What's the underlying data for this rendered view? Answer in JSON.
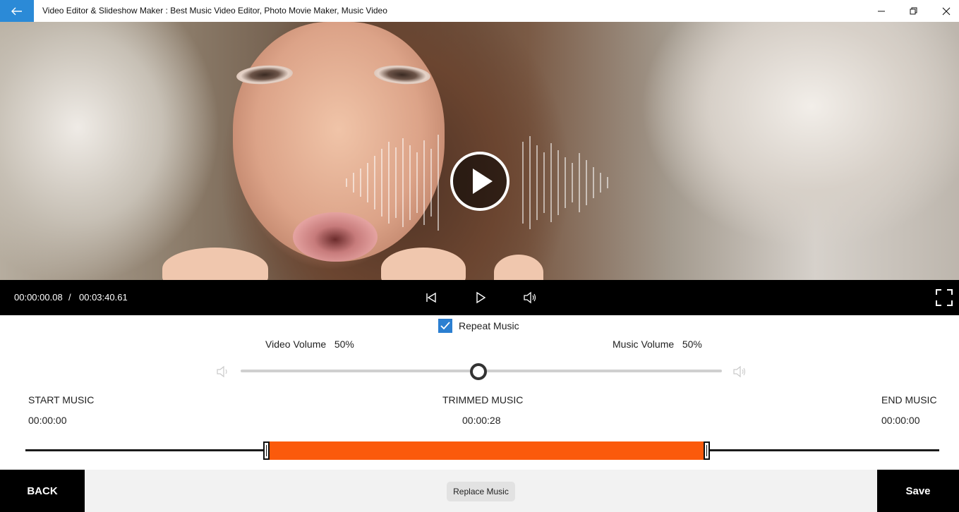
{
  "window": {
    "title": "Video Editor & Slideshow Maker : Best Music Video Editor, Photo Movie Maker, Music Video",
    "back_icon": "arrow-left-icon",
    "controls": [
      "minimize-icon",
      "restore-icon",
      "close-icon"
    ]
  },
  "player": {
    "current_time": "00:00:00.08",
    "separator": "/",
    "total_time": "00:03:40.61",
    "icons": [
      "skip-back-icon",
      "play-icon",
      "volume-icon",
      "fullscreen-icon"
    ]
  },
  "settings": {
    "repeat_music_label": "Repeat Music",
    "repeat_music_checked": true,
    "video_volume_label": "Video Volume",
    "video_volume_value": "50%",
    "music_volume_label": "Music Volume",
    "music_volume_value": "50%",
    "volume_balance": 0.5
  },
  "music": {
    "start_label": "START MUSIC",
    "start_time": "00:00:00",
    "trimmed_label": "TRIMMED MUSIC",
    "trimmed_time": "00:00:28",
    "end_label": "END MUSIC",
    "end_time": "00:00:00",
    "accent_color": "#fb5a0c"
  },
  "actions": {
    "back_label": "BACK",
    "replace_label": "Replace Music",
    "save_label": "Save"
  },
  "colors": {
    "title_accent": "#2b8ad7",
    "checkbox": "#2b7fd1",
    "bars": "#000000"
  }
}
